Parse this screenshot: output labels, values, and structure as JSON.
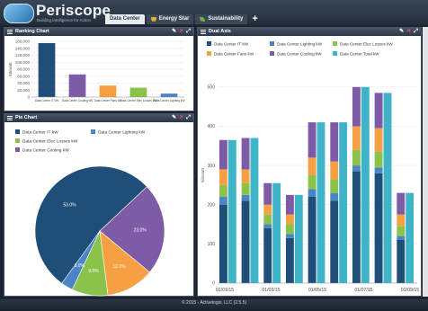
{
  "app": {
    "title": "Periscope",
    "tagline": "Building Intelligence for Action"
  },
  "tabs": [
    {
      "label": "Data Center",
      "active": true
    },
    {
      "label": "Energy Star",
      "active": false,
      "icon": "trophy-icon"
    },
    {
      "label": "Sustainability",
      "active": false,
      "icon": "leaf-icon"
    }
  ],
  "colors": {
    "it": "#1f4e79",
    "lighting": "#4a86c5",
    "elec_losses": "#8bc34a",
    "fans": "#f7a043",
    "cooling": "#7e5ba6",
    "total": "#3fb3c8"
  },
  "footer": {
    "text": "© 2015 - Activelogix, LLC (2.5.5)"
  },
  "panels": {
    "ranking": "Ranking Chart",
    "pie": "Pie Chart",
    "dual": "Dual Axis"
  },
  "chart_data": [
    {
      "type": "bar",
      "title": "Ranking Chart",
      "ylabel": "kilowatt",
      "ylim": [
        0,
        160000
      ],
      "yticks": [
        "0",
        "20,000",
        "40,000",
        "60,000",
        "80,000",
        "100,000",
        "120,000",
        "140,000",
        "160,000"
      ],
      "categories": [
        "Data Center IT kW",
        "Data Center Cooling kW",
        "Data Center Fans kW",
        "Data Center Elec Losses kW",
        "Data Center Lighting kW"
      ],
      "values": [
        155000,
        65000,
        33000,
        27000,
        10000
      ],
      "bar_colors": [
        "#1f4e79",
        "#7e5ba6",
        "#f7a043",
        "#8bc34a",
        "#4a86c5"
      ]
    },
    {
      "type": "pie",
      "title": "Pie Chart",
      "legend": [
        "Data Center IT kW",
        "Data Center Lighting kW",
        "Data Center Elec Losses kW",
        "Data Center Cooling kW"
      ],
      "slices": [
        {
          "label": "Data Center IT kW",
          "value": 53.0,
          "text": "53.0%",
          "color": "#1f4e79"
        },
        {
          "label": "Data Center Cooling kW",
          "value": 23.0,
          "text": "23.0%",
          "color": "#7e5ba6"
        },
        {
          "label": "Data Center Fans kW",
          "value": 12.0,
          "text": "12.0%",
          "color": "#f7a043"
        },
        {
          "label": "Data Center Elec Losses kW",
          "value": 9.0,
          "text": "9.0%",
          "color": "#8bc34a"
        },
        {
          "label": "Data Center Lighting kW",
          "value": 3.0,
          "text": "3.0%",
          "color": "#4a86c5"
        }
      ]
    },
    {
      "type": "bar",
      "title": "Dual Axis",
      "ylabel": "kilowatt",
      "ylim": [
        0,
        550
      ],
      "yticks": [
        "0",
        "100",
        "200",
        "300",
        "400",
        "500"
      ],
      "xticks": [
        "01/01/15",
        "01/03/15",
        "01/05/15",
        "01/07/15",
        "01/09/15"
      ],
      "legend": [
        "Data Center IT kW",
        "Data Center Lighting kW",
        "Data Center Elec Losses kW",
        "Data Center Fans kW",
        "Data Center Cooling kW",
        "Data Center Total kW"
      ],
      "stacked": [
        {
          "it": 200,
          "lighting": 20,
          "elec": 30,
          "fans": 40,
          "cooling": 75
        },
        {
          "it": 210,
          "lighting": 15,
          "elec": 30,
          "fans": 35,
          "cooling": 80
        },
        {
          "it": 140,
          "lighting": 10,
          "elec": 25,
          "fans": 25,
          "cooling": 55
        },
        {
          "it": 115,
          "lighting": 10,
          "elec": 25,
          "fans": 25,
          "cooling": 50
        },
        {
          "it": 220,
          "lighting": 20,
          "elec": 35,
          "fans": 45,
          "cooling": 90
        },
        {
          "it": 210,
          "lighting": 20,
          "elec": 35,
          "fans": 45,
          "cooling": 100
        },
        {
          "it": 285,
          "lighting": 15,
          "elec": 40,
          "fans": 60,
          "cooling": 100
        },
        {
          "it": 280,
          "lighting": 15,
          "elec": 40,
          "fans": 60,
          "cooling": 90
        },
        {
          "it": 110,
          "lighting": 10,
          "elec": 25,
          "fans": 30,
          "cooling": 55
        }
      ],
      "totals": [
        365,
        370,
        255,
        225,
        410,
        410,
        500,
        485,
        230
      ]
    }
  ]
}
